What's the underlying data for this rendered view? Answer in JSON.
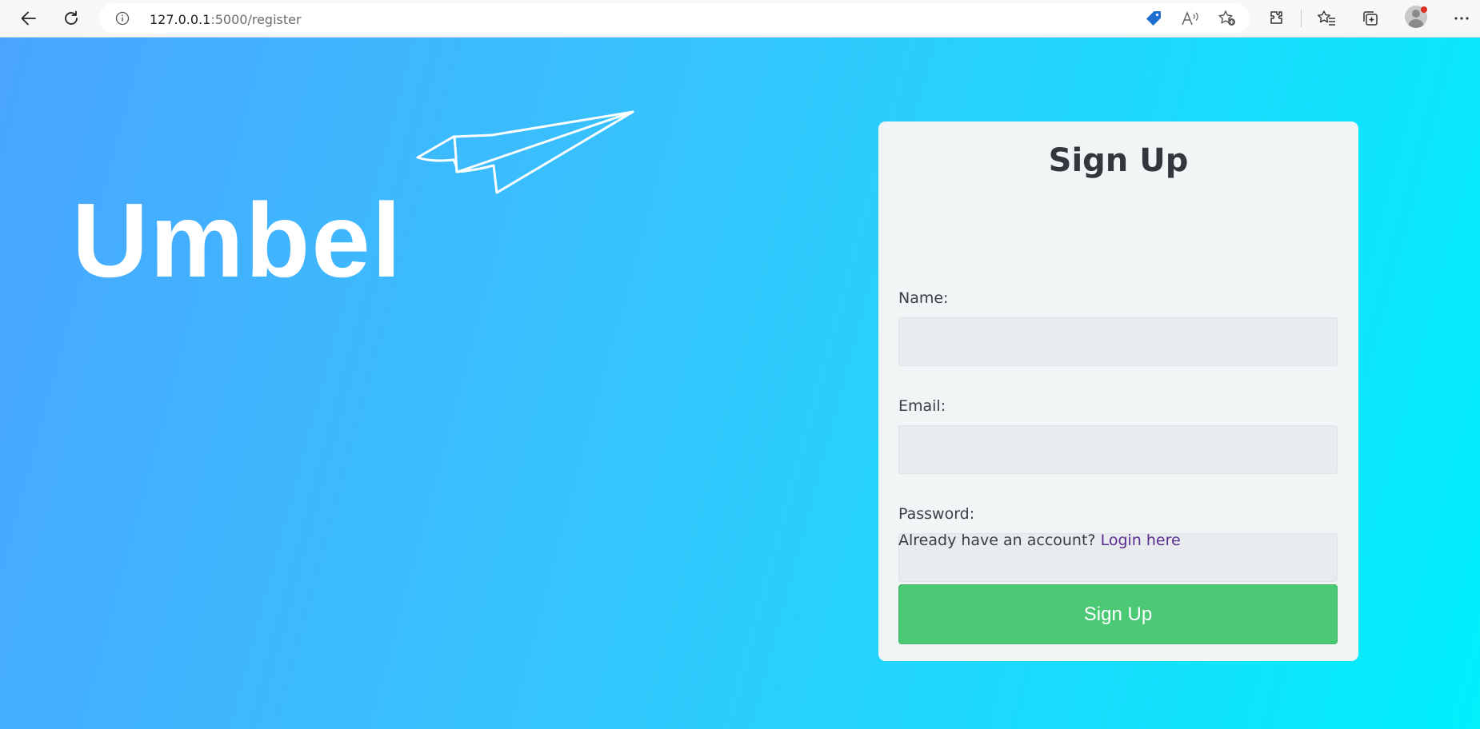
{
  "browser": {
    "address_host": "127.0.0.1",
    "address_path": ":5000/register",
    "icons": [
      "back-icon",
      "refresh-icon",
      "info-icon",
      "shopping-tag-icon",
      "read-aloud-icon",
      "add-favorite-icon",
      "extensions-icon",
      "favorites-icon",
      "collections-icon",
      "profile-avatar",
      "more-options-icon"
    ]
  },
  "brand": {
    "logo_text": "Umbel",
    "logo_color": "#ffffff"
  },
  "colors": {
    "gradient_start": "#4aa5ff",
    "gradient_end": "#00f0fc",
    "button": "#4bc974",
    "link": "#5b2b8f"
  },
  "form": {
    "title": "Sign Up",
    "name_label": "Name:",
    "name_value": "",
    "email_label": "Email:",
    "email_value": "",
    "password_label": "Password:",
    "password_value": "",
    "account_prompt": "Already have an account? ",
    "login_link": "Login here",
    "submit_label": "Sign Up"
  }
}
